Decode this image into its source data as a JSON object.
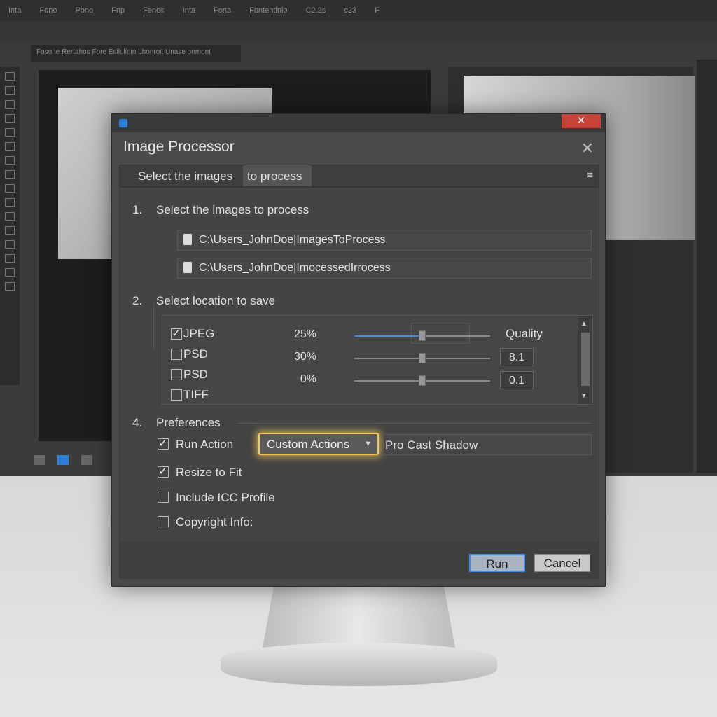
{
  "background_app": {
    "menu_items": [
      "Inta",
      "Fono",
      "Pono",
      "Fnp",
      "Fenos",
      "Inta",
      "Fona",
      "Fontehtinio",
      "C2.2s",
      "c23",
      "F"
    ],
    "doc_tab": "Fasone Rertahos Fore Esilulioin Lhonroit Unase onmont"
  },
  "dialog": {
    "title": "Image Processor",
    "close_glyph": "✕",
    "tabs": {
      "tab1": "Select the images",
      "tab2": "to process",
      "menu_glyph": "≡"
    },
    "section1": {
      "num": "1.",
      "label": "Select the images to process",
      "paths": [
        "C:\\Users_JohnDoe|ImagesToProcess",
        "C:\\Users_JohnDoe|ImocessedIrrocess"
      ]
    },
    "section2": {
      "num": "2.",
      "label": "Select location to save",
      "formats": [
        {
          "label": "JPEG",
          "checked": true
        },
        {
          "label": "PSD",
          "checked": false
        },
        {
          "label": "PSD",
          "checked": false
        },
        {
          "label": "TIFF",
          "checked": false
        }
      ],
      "sliders": [
        {
          "pct_label": "25%",
          "value": 0.5,
          "filled": true
        },
        {
          "pct_label": "30%",
          "value": 0.5,
          "filled": false
        },
        {
          "pct_label": "0%",
          "value": 0.5,
          "filled": false
        }
      ],
      "quality_label": "Quality",
      "quality_values": [
        "8.1",
        "0.1"
      ]
    },
    "section4": {
      "num": "4.",
      "label": "Preferences",
      "run_action": {
        "label": "Run Action",
        "checked": true
      },
      "dropdown_value": "Custom Actions",
      "action_value": "Pro Cast Shadow",
      "resize": {
        "label": "Resize to Fit",
        "checked": true
      },
      "icc": {
        "label": "Include ICC Profile",
        "checked": false
      },
      "copyright": {
        "label": "Copyright Info:",
        "checked": false
      }
    },
    "buttons": {
      "run": "Run",
      "cancel": "Cancel"
    }
  },
  "colors": {
    "accent": "#3a8ee6",
    "highlight": "#f0c95a",
    "close_red": "#c8423a",
    "dialog_bg": "#4a4a4a"
  }
}
